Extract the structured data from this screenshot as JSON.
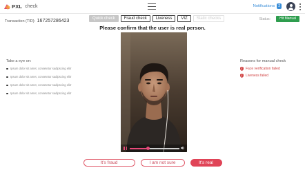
{
  "app": {
    "logo_text": "PXL",
    "logo_sub": "check"
  },
  "topbar": {
    "notifications_label": "Notifications",
    "notifications_count": "2"
  },
  "transaction": {
    "label": "Transaction (TID):",
    "id": "167257286423"
  },
  "tabs": [
    {
      "label": "Quick check",
      "state": "quick"
    },
    {
      "label": "Fraud check",
      "state": "normal"
    },
    {
      "label": "Liveness",
      "state": "normal"
    },
    {
      "label": "VIZ",
      "state": "normal"
    },
    {
      "label": "Static checks",
      "state": "ghost"
    }
  ],
  "status": {
    "label": "Status:",
    "value": "Hit Manual"
  },
  "main": {
    "confirm_text": "Please confirm that the user is real person."
  },
  "video": {
    "progress_fraction": 0.37
  },
  "left_panel": {
    "title": "Take a eye on:",
    "items": [
      "Ipsum dolor sit amet, consetetur sadipscing elitr",
      "Ipsum dolor sit amet, consetetur sadipscing elitr",
      "Ipsum dolor sit amet, consetetur sadipscing elitr",
      "Ipsum dolor sit amet, consetetur sadipscing elitr"
    ]
  },
  "right_panel": {
    "title": "Reasons for manual check",
    "reasons": [
      "Face verification failed",
      "Liveness failed"
    ]
  },
  "actions": {
    "fraud_label": "It's fraud",
    "not_sure_label": "I am not sure",
    "real_label": "It's real"
  },
  "colors": {
    "accent": "#e04457",
    "status_green": "#2e9d4e",
    "link_blue": "#3a8ed8",
    "reason_red": "#d04343"
  }
}
